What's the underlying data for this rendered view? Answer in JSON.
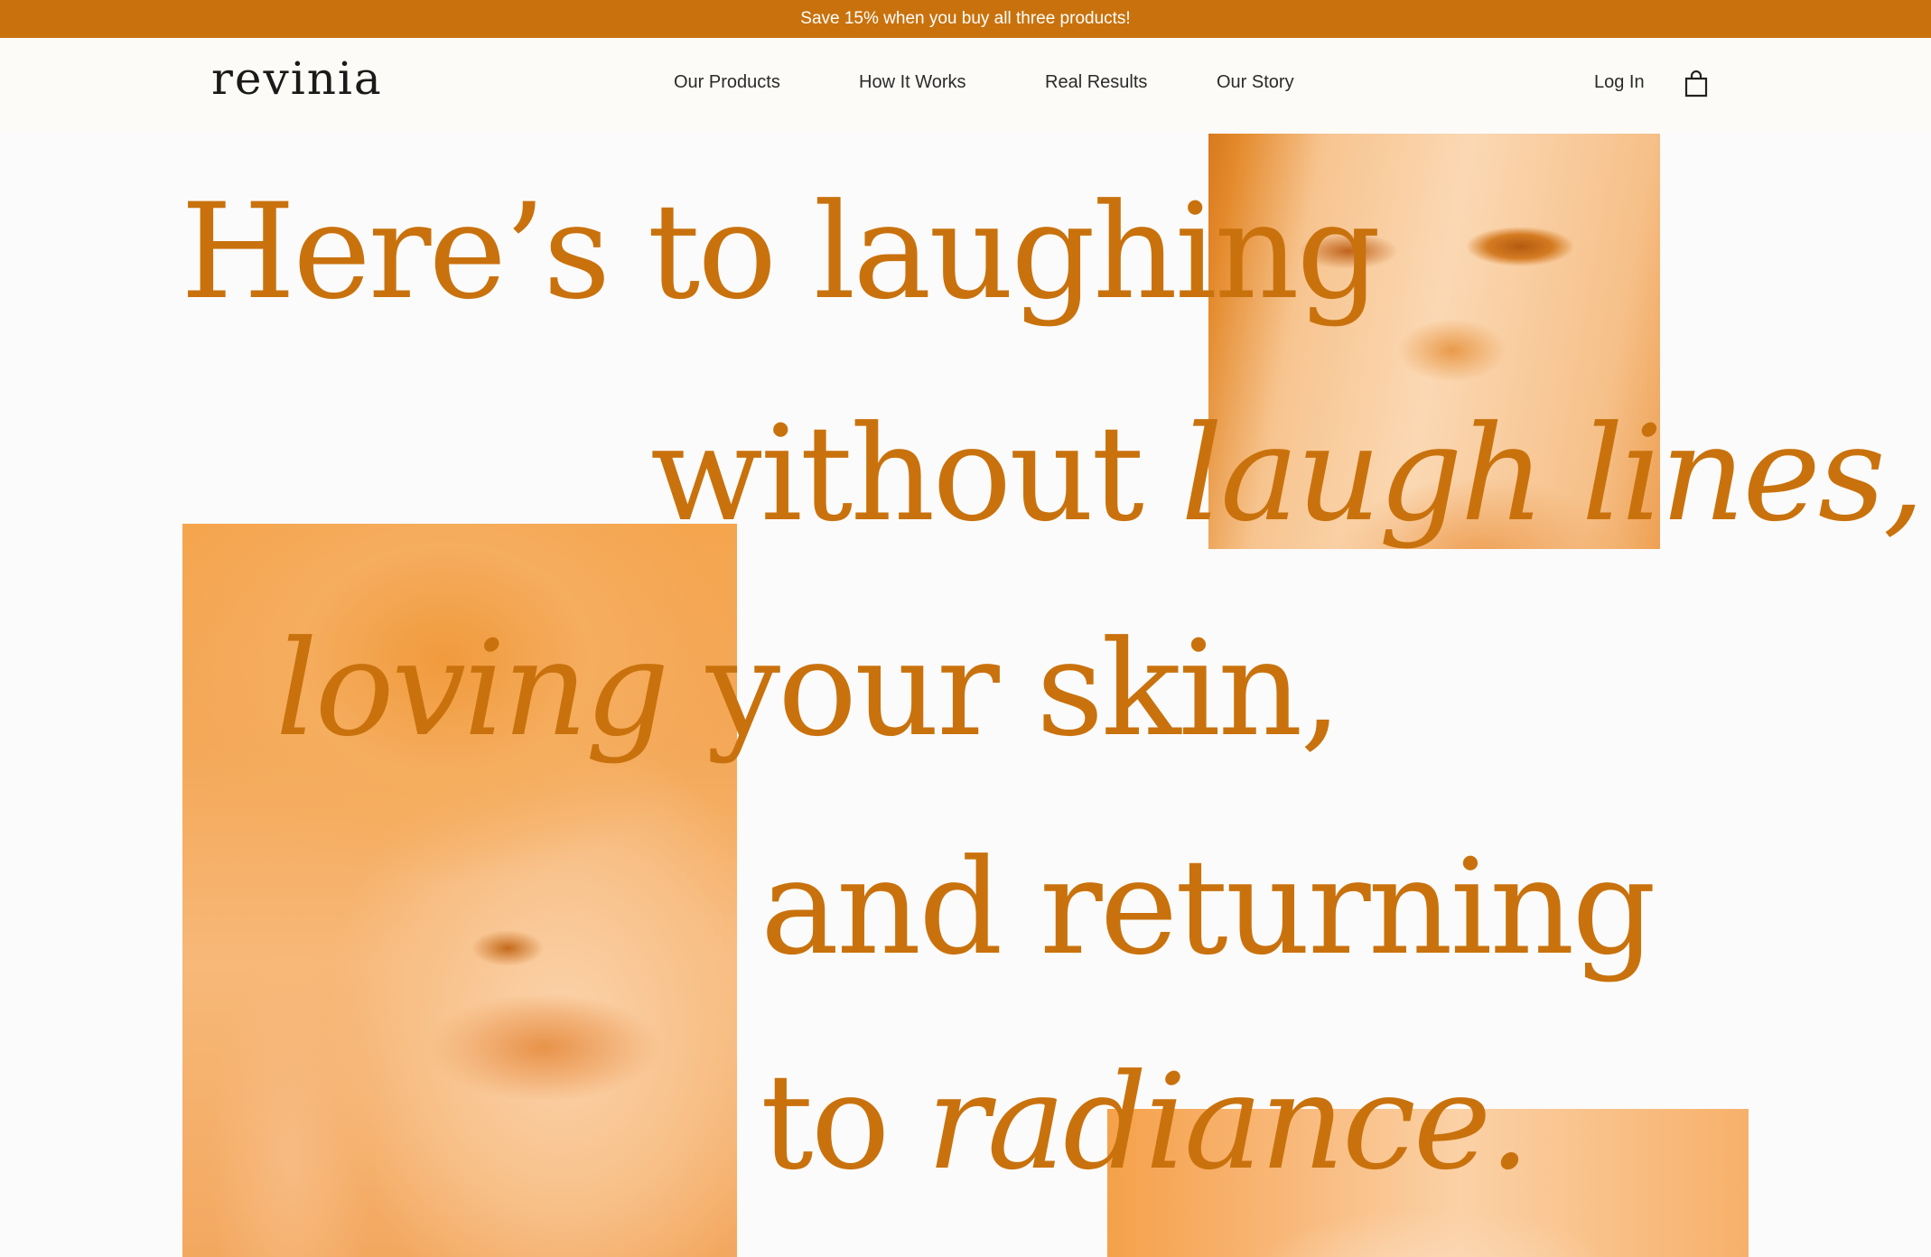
{
  "promo": {
    "text": "Save 15% when you buy all three products!"
  },
  "header": {
    "logo": "revinia",
    "nav": [
      {
        "label": "Our Products"
      },
      {
        "label": "How It Works"
      },
      {
        "label": "Real Results"
      },
      {
        "label": "Our Story"
      }
    ],
    "login_label": "Log In",
    "cart_icon": "shopping-bag-icon"
  },
  "hero": {
    "line1": "Here’s to laughing",
    "line2_plain": "without ",
    "line2_italic": "laugh lines,",
    "line3_italic": "loving",
    "line3_plain": " your skin,",
    "line4": "and returning",
    "line5_plain": "to ",
    "line5_italic": "radiance."
  },
  "colors": {
    "accent": "#c9720d",
    "background": "#fcfbfb",
    "photo_tint": "#f5a54e"
  }
}
